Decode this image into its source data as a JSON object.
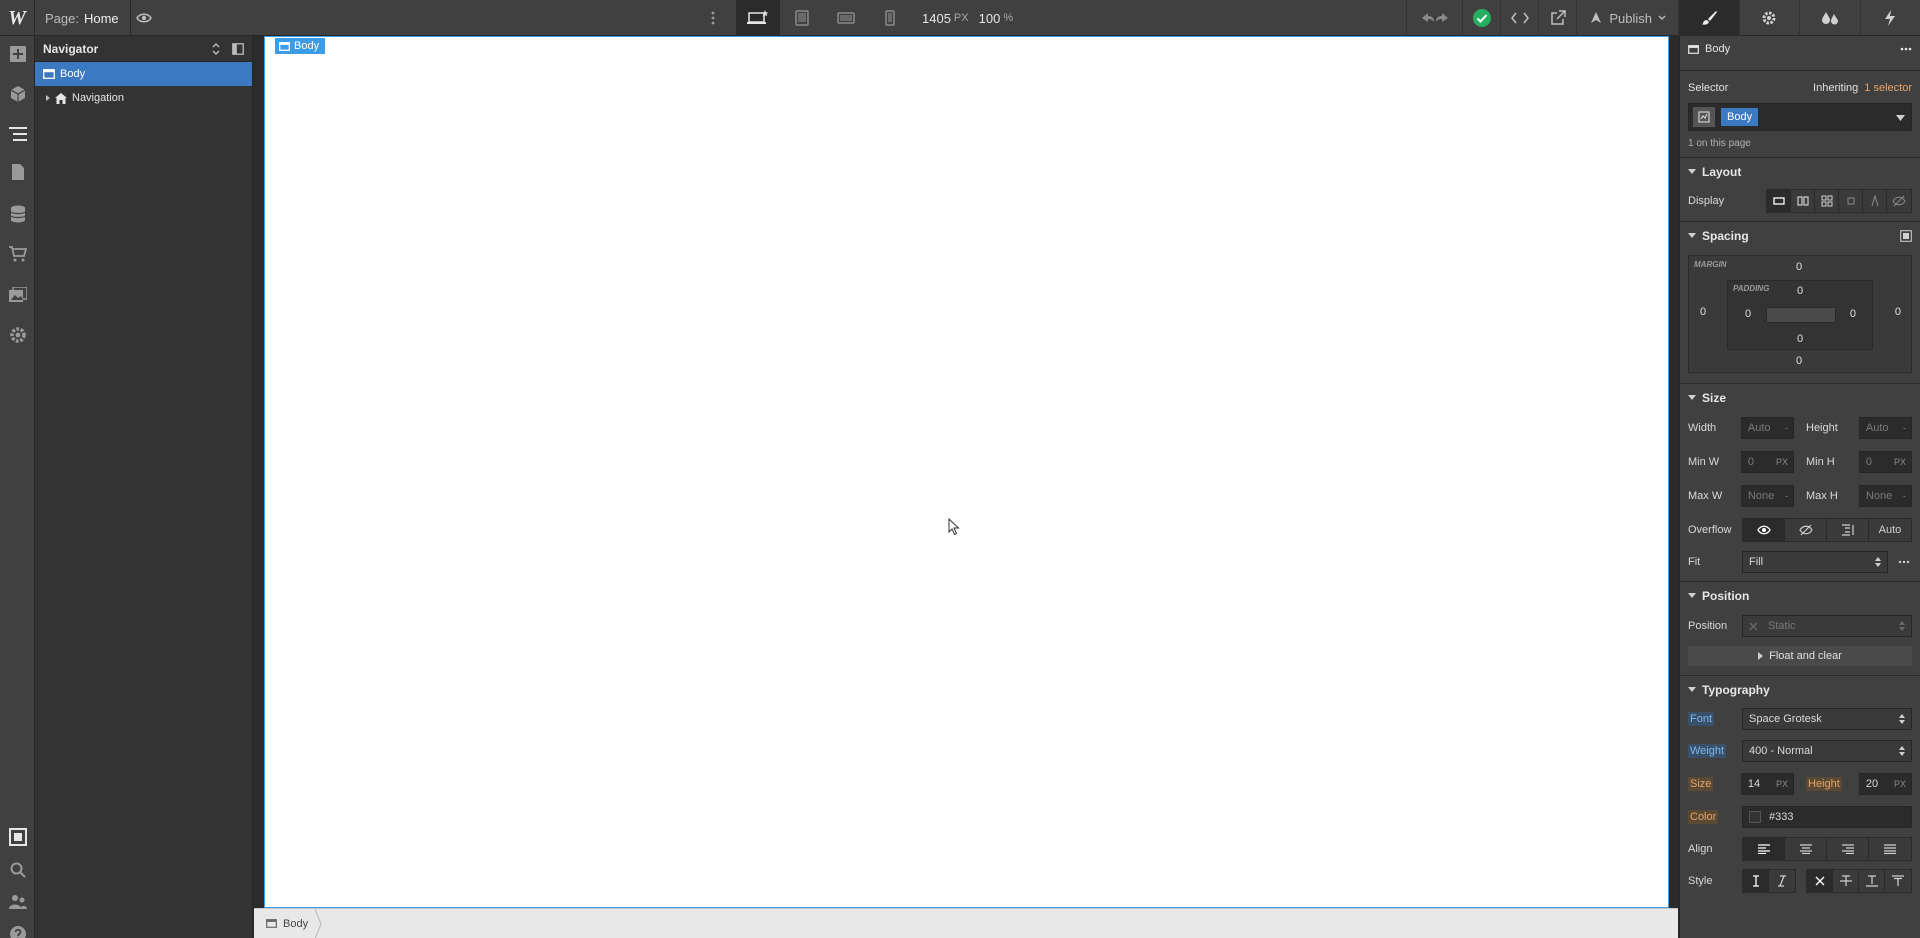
{
  "app": {
    "logo": "W"
  },
  "topbar": {
    "page_label": "Page:",
    "page_name": "Home",
    "canvas_width": "1405",
    "canvas_width_unit": "PX",
    "zoom": "100",
    "zoom_unit": "%",
    "publish_label": "Publish",
    "status_color": "#27ae60"
  },
  "navigator": {
    "title": "Navigator",
    "tree": [
      {
        "label": "Body",
        "icon": "box-icon",
        "selected": true
      },
      {
        "label": "Navigation",
        "icon": "home-icon",
        "selected": false
      }
    ]
  },
  "canvas": {
    "selected_tag": "Body",
    "accent_color": "#3b9ce8"
  },
  "breadcrumb": {
    "items": [
      "Body"
    ]
  },
  "style_panel": {
    "element_name": "Body",
    "selector": {
      "label": "Selector",
      "inheriting_prefix": "Inheriting",
      "inheriting_link": "1 selector",
      "tag": "Body",
      "count_text": "1 on this page"
    },
    "layout": {
      "title": "Layout",
      "display_label": "Display"
    },
    "spacing": {
      "title": "Spacing",
      "margin_label": "MARGIN",
      "padding_label": "PADDING",
      "margin": {
        "top": "0",
        "right": "0",
        "bottom": "0",
        "left": "0"
      },
      "padding": {
        "top": "0",
        "right": "0",
        "bottom": "0",
        "left": "0"
      }
    },
    "size": {
      "title": "Size",
      "width_label": "Width",
      "width_value": "Auto",
      "width_unit": "-",
      "height_label": "Height",
      "height_value": "Auto",
      "height_unit": "-",
      "minw_label": "Min W",
      "minw_value": "0",
      "minw_unit": "PX",
      "minh_label": "Min H",
      "minh_value": "0",
      "minh_unit": "PX",
      "maxw_label": "Max W",
      "maxw_value": "None",
      "maxw_unit": "-",
      "maxh_label": "Max H",
      "maxh_value": "None",
      "maxh_unit": "-",
      "overflow_label": "Overflow",
      "overflow_auto": "Auto",
      "fit_label": "Fit",
      "fit_value": "Fill"
    },
    "position": {
      "title": "Position",
      "position_label": "Position",
      "position_value": "Static",
      "float_label": "Float and clear"
    },
    "typography": {
      "title": "Typography",
      "font_label": "Font",
      "font_value": "Space Grotesk",
      "weight_label": "Weight",
      "weight_value": "400 - Normal",
      "size_label": "Size",
      "size_value": "14",
      "size_unit": "PX",
      "height_label": "Height",
      "height_value": "20",
      "height_unit": "PX",
      "color_label": "Color",
      "color_value": "#333",
      "align_label": "Align",
      "style_label": "Style"
    }
  }
}
